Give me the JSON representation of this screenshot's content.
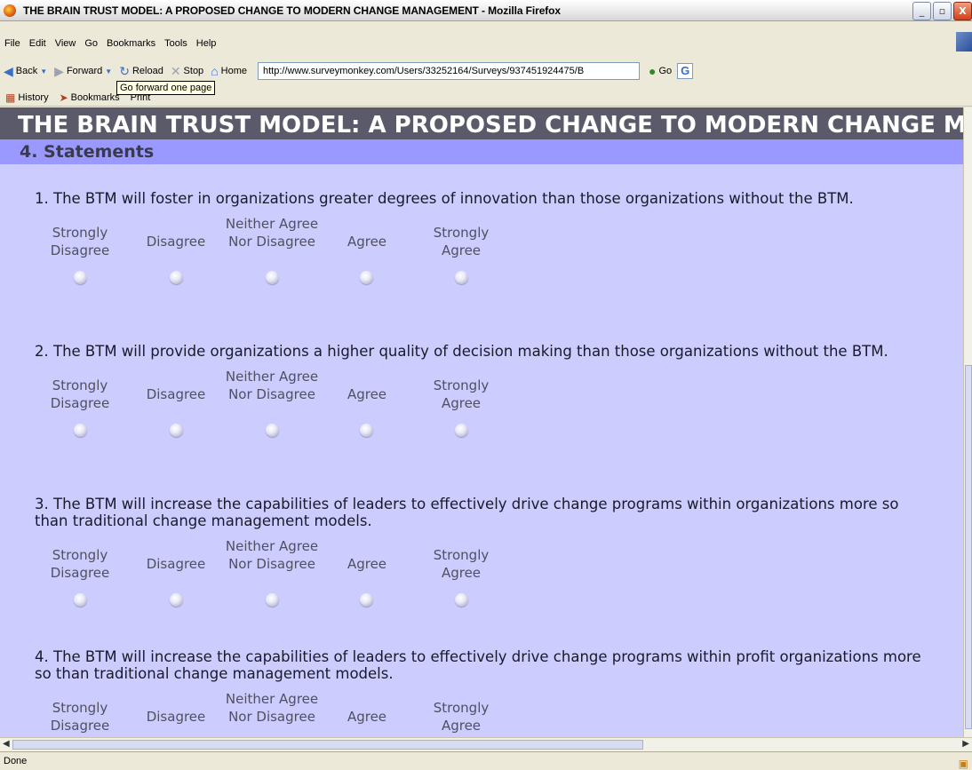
{
  "window": {
    "title": "THE BRAIN TRUST MODEL: A PROPOSED CHANGE TO MODERN CHANGE MANAGEMENT - Mozilla Firefox",
    "buttons": {
      "minimize": "_",
      "maximize": "▫",
      "close": "X"
    }
  },
  "menubar": {
    "items": [
      "File",
      "Edit",
      "View",
      "Go",
      "Bookmarks",
      "Tools",
      "Help"
    ]
  },
  "navbar": {
    "back_label": "Back",
    "forward_label": "Forward",
    "reload_label": "Reload",
    "stop_label": "Stop",
    "home_label": "Home",
    "url": "http://www.surveymonkey.com/Users/33252164/Surveys/937451924475/B",
    "go_label": "Go",
    "search_engine_glyph": "G"
  },
  "tooltip": "Go forward one page",
  "bookmarks": {
    "history_label": "History",
    "bookmarks_label": "Bookmarks",
    "print_label": "Print"
  },
  "survey": {
    "title": "THE BRAIN TRUST MODEL: A PROPOSED CHANGE TO MODERN CHANGE MANAGEMENT",
    "section": "4. Statements",
    "scale_labels": [
      "Strongly Disagree",
      "Disagree",
      "Neither Agree Nor Disagree",
      "Agree",
      "Strongly Agree"
    ],
    "questions": [
      {
        "text": "1. The BTM will foster in organizations greater degrees of innovation than those organizations without the BTM."
      },
      {
        "text": "2. The BTM will provide organizations a higher quality of decision making than those organizations without the BTM."
      },
      {
        "text": "3. The BTM will increase the capabilities of leaders to effectively drive change programs within organizations more so than traditional change management models."
      },
      {
        "text": "4. The BTM will increase the capabilities of leaders to effectively drive change programs within profit organizations more so than traditional change management models."
      }
    ]
  },
  "status": "Done"
}
